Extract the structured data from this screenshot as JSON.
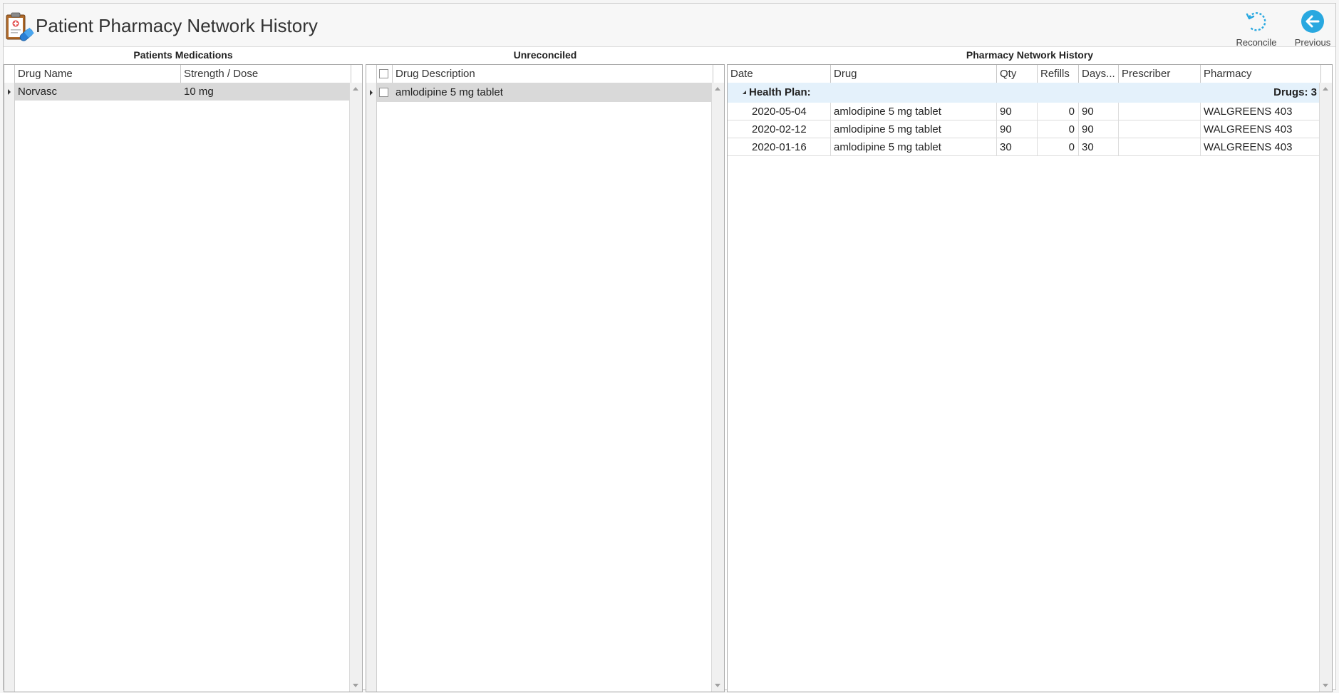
{
  "window": {
    "title": "Patient Pharmacy Network History"
  },
  "toolbar": {
    "reconcile_label": "Reconcile",
    "previous_label": "Previous",
    "accent_color": "#29a8e0"
  },
  "patients_medications": {
    "title": "Patients Medications",
    "columns": [
      "Drug Name",
      "Strength / Dose"
    ],
    "rows": [
      {
        "drug_name": "Norvasc",
        "strength": "10 mg"
      }
    ]
  },
  "unreconciled": {
    "title": "Unreconciled",
    "columns": [
      "Drug Description"
    ],
    "rows": [
      {
        "description": "amlodipine 5 mg tablet",
        "checked": false
      }
    ]
  },
  "pharmacy_history": {
    "title": "Pharmacy Network History",
    "columns": [
      "Date",
      "Drug",
      "Qty",
      "Refills",
      "Days...",
      "Prescriber",
      "Pharmacy"
    ],
    "group": {
      "label": "Health Plan:",
      "count_label": "Drugs: 3"
    },
    "rows": [
      {
        "date": "2020-05-04",
        "drug": "amlodipine 5 mg tablet",
        "qty": "90",
        "refills": "0",
        "days": "90",
        "prescriber": "",
        "pharmacy": "WALGREENS 403"
      },
      {
        "date": "2020-02-12",
        "drug": "amlodipine 5 mg tablet",
        "qty": "90",
        "refills": "0",
        "days": "90",
        "prescriber": "",
        "pharmacy": "WALGREENS 403"
      },
      {
        "date": "2020-01-16",
        "drug": "amlodipine 5 mg tablet",
        "qty": "30",
        "refills": "0",
        "days": "30",
        "prescriber": "",
        "pharmacy": "WALGREENS 403"
      }
    ]
  }
}
